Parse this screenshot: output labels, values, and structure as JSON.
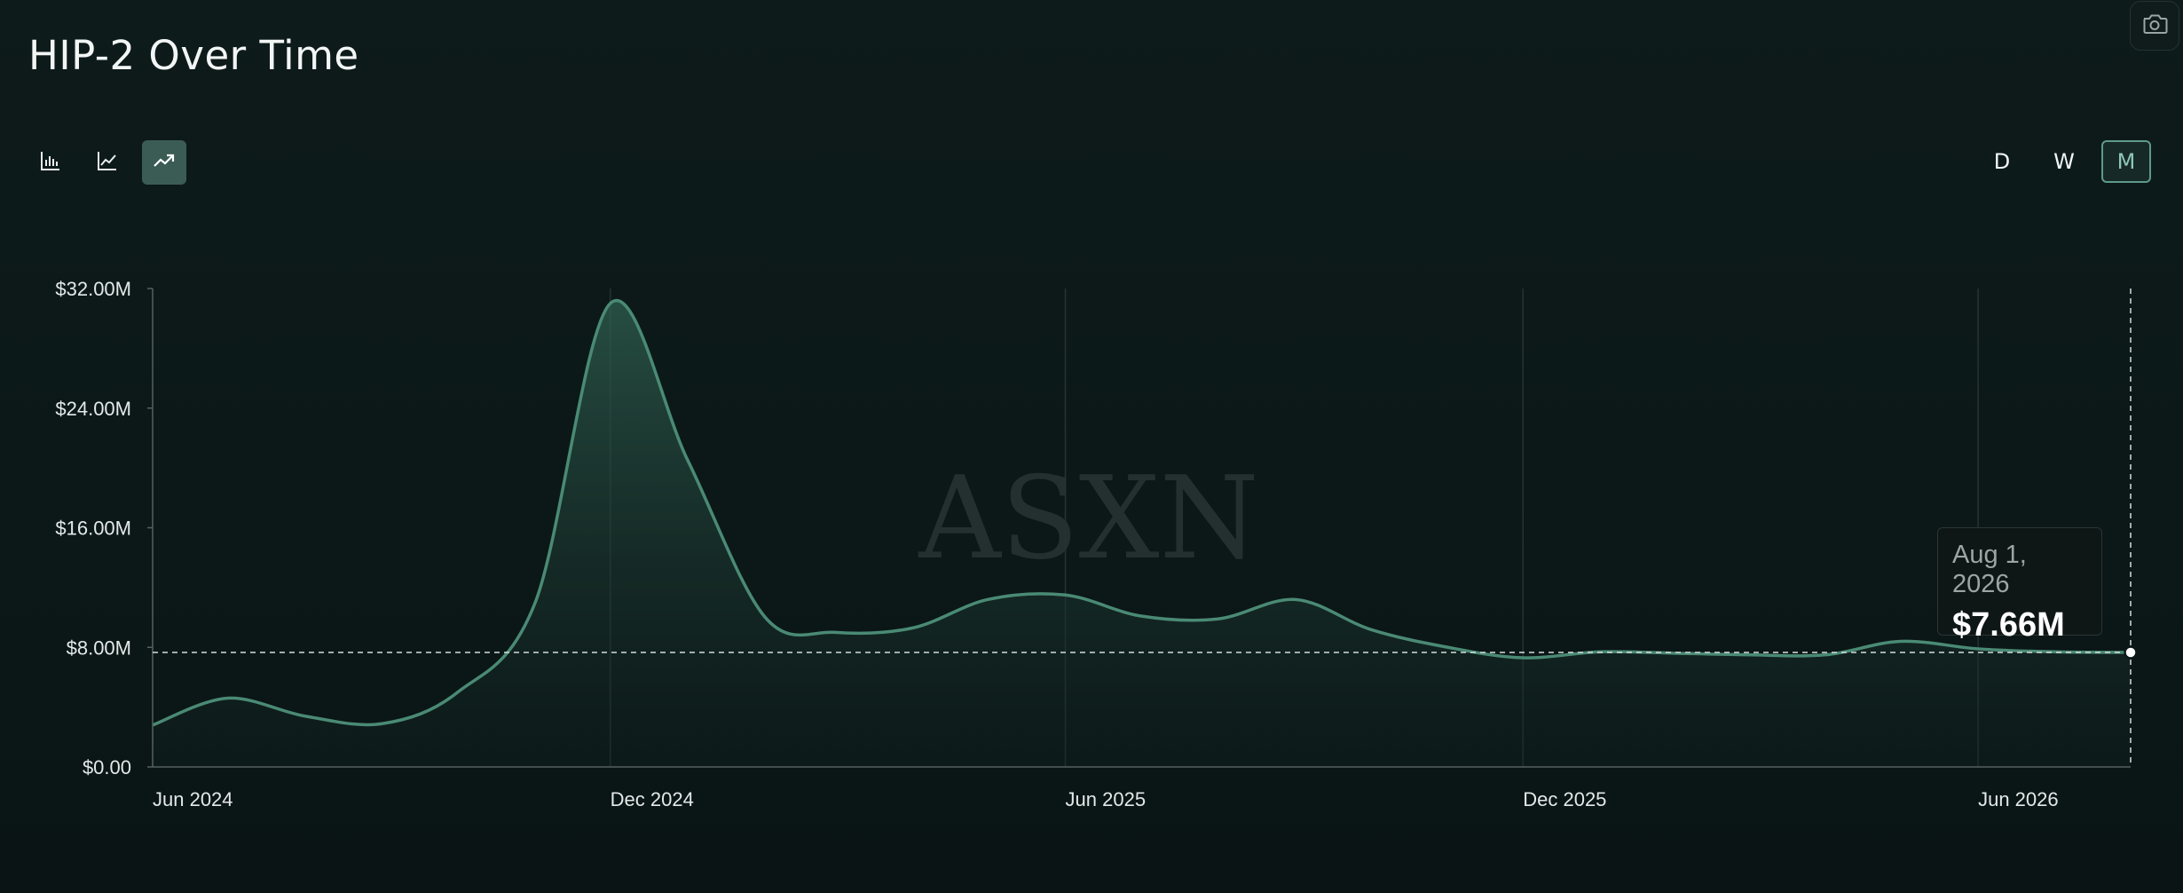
{
  "title": "HIP-2 Over Time",
  "controls": {
    "chart_types": [
      {
        "icon": "bar-chart-icon",
        "active": false
      },
      {
        "icon": "line-chart-icon",
        "active": false
      },
      {
        "icon": "trending-up-icon",
        "active": true
      }
    ],
    "intervals": [
      "D",
      "W",
      "M"
    ],
    "active_interval": "M",
    "screenshot_icon": "camera-icon"
  },
  "watermark": "ASXN",
  "tooltip": {
    "date": "Aug 1, 2026",
    "value": "$7.66M"
  },
  "colors": {
    "line": "#4a8a74",
    "accent": "#8fc7b7",
    "fill_top": "#2f5f50"
  },
  "chart_data": {
    "type": "area",
    "title": "HIP-2 Over Time",
    "xlabel": "",
    "ylabel": "",
    "ylim": [
      0,
      32000000
    ],
    "yticks": [
      0,
      8000000,
      16000000,
      24000000,
      32000000
    ],
    "ytick_labels": [
      "$0.00",
      "$8.00M",
      "$16.00M",
      "$24.00M",
      "$32.00M"
    ],
    "xlim": [
      "2024-06-01",
      "2026-08-01"
    ],
    "xticks": [
      "2024-06-01",
      "2024-12-01",
      "2025-06-01",
      "2025-12-01",
      "2026-06-01"
    ],
    "xtick_labels": [
      "Jun 2024",
      "Dec 2024",
      "Jun 2025",
      "Dec 2025",
      "Jun 2026"
    ],
    "grid": true,
    "legend": "none",
    "series": [
      {
        "x": [
          "2024-06-01",
          "2024-07-01",
          "2024-08-01",
          "2024-09-01",
          "2024-10-01",
          "2024-11-01",
          "2024-12-01",
          "2025-01-01",
          "2025-02-01",
          "2025-03-01",
          "2025-04-01",
          "2025-05-01",
          "2025-06-01",
          "2025-07-01",
          "2025-08-01",
          "2025-09-01",
          "2025-10-01",
          "2025-11-01",
          "2025-12-01",
          "2026-01-01",
          "2026-02-01",
          "2026-03-01",
          "2026-04-01",
          "2026-05-01",
          "2026-06-01",
          "2026-07-01",
          "2026-08-01"
        ],
        "values": [
          2800000,
          4600000,
          3400000,
          2900000,
          5000000,
          11000000,
          31000000,
          20500000,
          10000000,
          9000000,
          9300000,
          11200000,
          11500000,
          10100000,
          9900000,
          11200000,
          9200000,
          8000000,
          7300000,
          7700000,
          7600000,
          7500000,
          7500000,
          8400000,
          7900000,
          7700000,
          7660000
        ]
      }
    ],
    "reference_value": 7660000,
    "highlighted_point": {
      "x": "2026-08-01",
      "y": 7660000
    }
  }
}
